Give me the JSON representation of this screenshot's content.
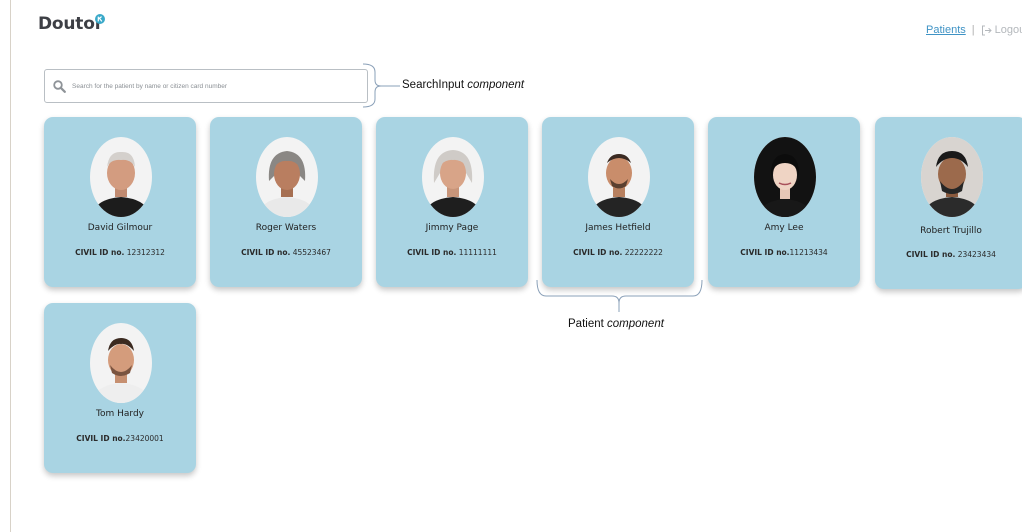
{
  "header": {
    "logo": "Doutor",
    "nav_patients": "Patients",
    "nav_separator": "|",
    "nav_logout": "Logou"
  },
  "search": {
    "placeholder": "Search for the patient by name or citizen card number"
  },
  "annotations": {
    "search_name": "SearchInput",
    "search_suffix": "component",
    "patient_name": "Patient",
    "patient_suffix": "component"
  },
  "patients": [
    {
      "name": "David Gilmour",
      "id_label": "CIVIL ID no.",
      "id_value": "12312312"
    },
    {
      "name": "Roger Waters",
      "id_label": "CIVIL ID no.",
      "id_value": "45523467"
    },
    {
      "name": "Jimmy Page",
      "id_label": "CIVIL ID no.",
      "id_value": "11111111"
    },
    {
      "name": "James Hetfield",
      "id_label": "CIVIL ID no.",
      "id_value": "22222222"
    },
    {
      "name": "Amy Lee",
      "id_label": "CIVIL ID no.",
      "id_value": "11213434"
    },
    {
      "name": "Robert Trujillo",
      "id_label": "CIVIL ID no.",
      "id_value": "23423434"
    },
    {
      "name": "Tom Hardy",
      "id_label": "CIVIL ID no.",
      "id_value": "23420001"
    }
  ],
  "icons": {
    "search": "search-icon",
    "logout": "logout-icon",
    "logo_badge": "logo-badge-icon"
  },
  "colors": {
    "card_bg": "#a9d4e3",
    "link": "#3f93c5",
    "logo_badge": "#3aa9c9"
  }
}
